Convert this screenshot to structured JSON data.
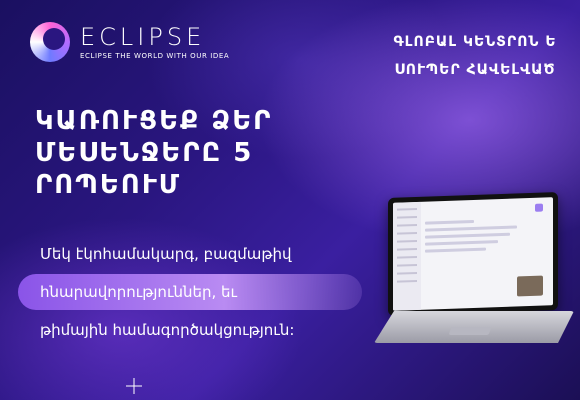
{
  "brand": {
    "name": "ECLIPSE",
    "tagline": "ECLIPSE THE WORLD WITH OUR IDEA"
  },
  "top_right": {
    "line1": "ԳԼՈԲԱԼ ԿԵՆՏՐՈՆ Ե",
    "line2": "ՍՈՒՊԵՐ ՀԱՎԵԼՎԱԾ"
  },
  "headline": {
    "line1": "ԿԱՌՈՒՑԵՔ ՁԵՐ",
    "line2": "ՄԵՍԵՆՋԵՐԸ 5",
    "line3": "ՐՈՊԵՈՒՄ"
  },
  "subtext": {
    "line1": "Մեկ էկոհամակարգ, բազմաթիվ",
    "line2": "հնարավորություններ, եւ",
    "line3": "թիմային համագործակցություն:"
  },
  "colors": {
    "background": "#2a1680",
    "accent": "#8a54e8"
  },
  "icons": [
    "eclipse-logo-icon",
    "laptop-illustration",
    "sparkle-icon"
  ]
}
